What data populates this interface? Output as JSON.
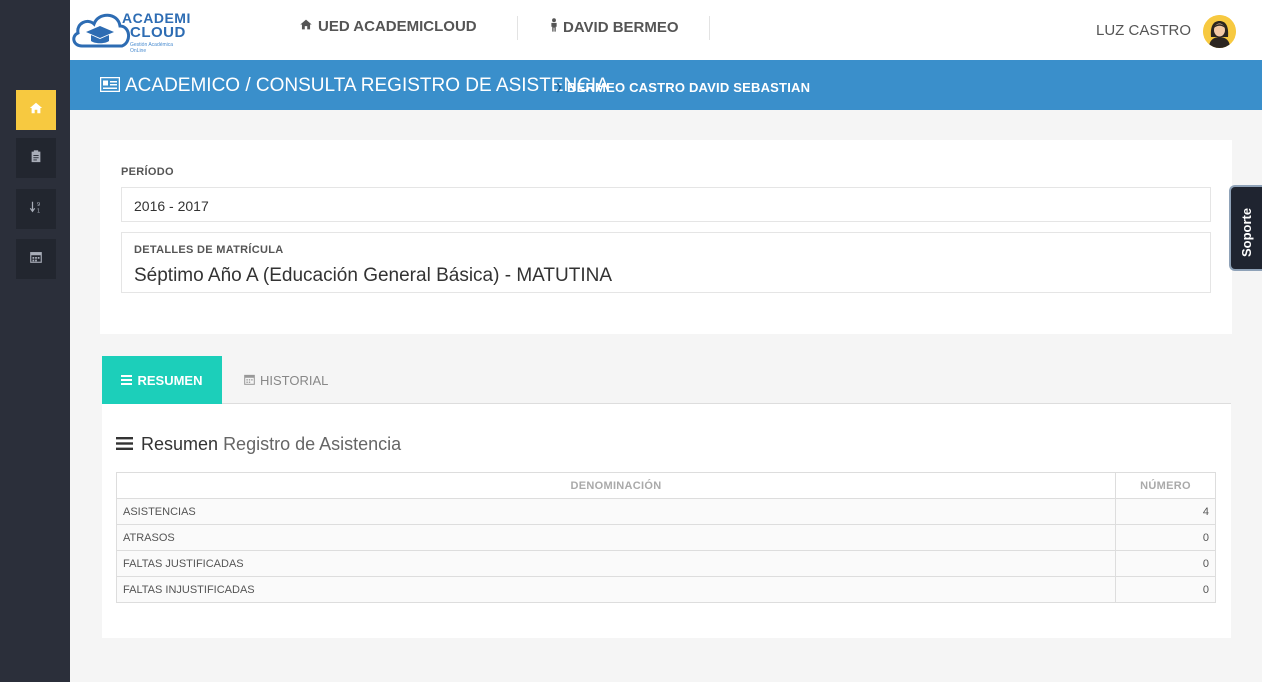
{
  "logo": {
    "line1": "ACADEMI",
    "line2": "CLOUD",
    "sub": "Gestión Académica OnLine"
  },
  "topbar": {
    "institution": "UED ACADEMICLOUD",
    "student": "DAVID BERMEO",
    "user": "LUZ CASTRO"
  },
  "breadcrumb": {
    "main": "ACADEMICO / CONSULTA REGISTRO DE ASISTENCIA",
    "sub": "BERMEO CASTRO DAVID SEBASTIAN"
  },
  "periodo": {
    "label": "PERÍODO",
    "value": "2016 - 2017"
  },
  "matricula": {
    "label": "DETALLES DE MATRÍCULA",
    "value": "Séptimo Año A (Educación General Básica) - MATUTINA"
  },
  "soporte": "Soporte",
  "tabs": [
    {
      "label": "RESUMEN",
      "icon": "list-icon"
    },
    {
      "label": "HISTORIAL",
      "icon": "calendar-icon"
    }
  ],
  "section": {
    "bold": "Resumen",
    "light": "Registro de Asistencia"
  },
  "table": {
    "headers": [
      "DENOMINACIÓN",
      "NÚMERO"
    ],
    "rows": [
      [
        "ASISTENCIAS",
        "4"
      ],
      [
        "ATRASOS",
        "0"
      ],
      [
        "FALTAS JUSTIFICADAS",
        "0"
      ],
      [
        "FALTAS INJUSTIFICADAS",
        "0"
      ]
    ]
  },
  "colors": {
    "accent": "#3a8fcb",
    "tab_active": "#1ccfba",
    "sidebar": "#2b2f3a",
    "home_active": "#f7c940"
  },
  "sidebar": {
    "items": [
      "home-icon",
      "clipboard-icon",
      "sort-numeric-icon",
      "calendar-icon"
    ]
  }
}
